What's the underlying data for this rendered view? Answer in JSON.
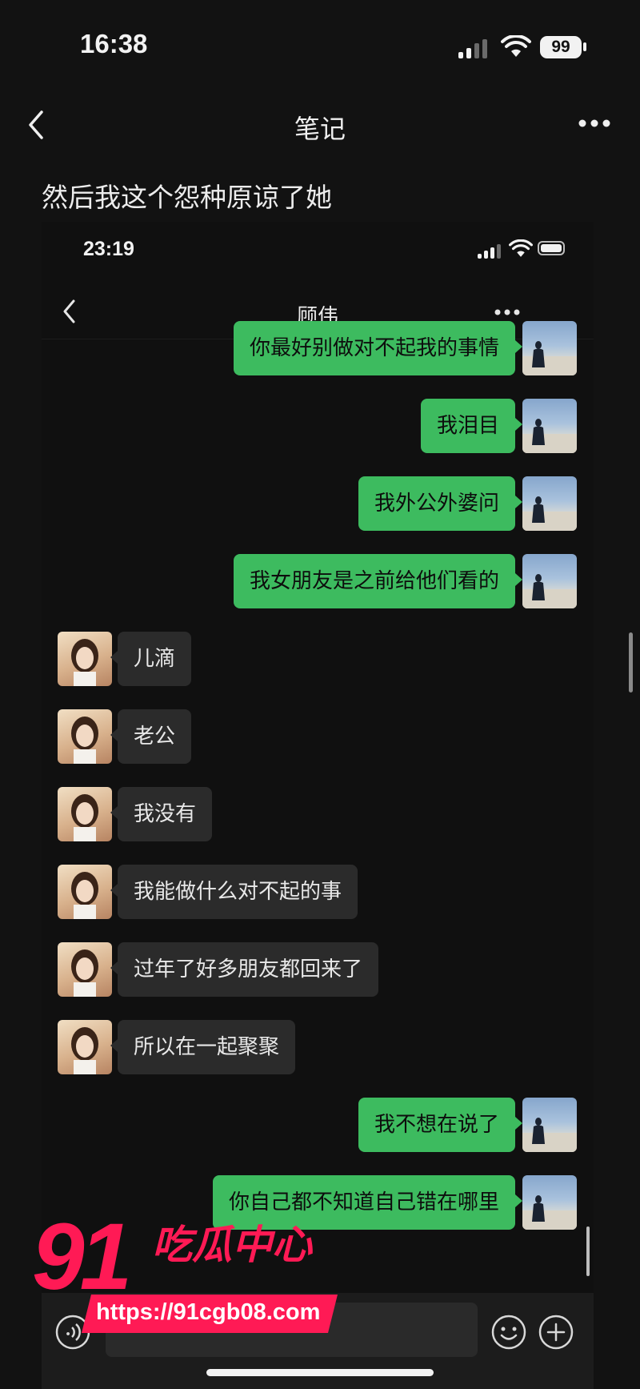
{
  "status_bar": {
    "time": "16:38",
    "battery": "99",
    "signal_icon": "signal-icon",
    "wifi_icon": "wifi-icon"
  },
  "nav": {
    "title": "笔记",
    "back_icon": "back-icon",
    "more_icon": "more-icon"
  },
  "caption": "然后我这个怨种原谅了她",
  "embedded": {
    "status_bar": {
      "time": "23:19"
    },
    "chat": {
      "title": "顾伟"
    },
    "messages": [
      {
        "side": "sent",
        "text": "你最好别做对不起我的事情"
      },
      {
        "side": "sent",
        "text": "我泪目"
      },
      {
        "side": "sent",
        "text": "我外公外婆问"
      },
      {
        "side": "sent",
        "text": "我女朋友是之前给他们看的"
      },
      {
        "side": "received",
        "text": "儿滴"
      },
      {
        "side": "received",
        "text": "老公"
      },
      {
        "side": "received",
        "text": "我没有"
      },
      {
        "side": "received",
        "text": "我能做什么对不起的事"
      },
      {
        "side": "received",
        "text": "过年了好多朋友都回来了"
      },
      {
        "side": "received",
        "text": "所以在一起聚聚"
      },
      {
        "side": "sent",
        "text": "我不想在说了"
      },
      {
        "side": "sent",
        "text": "你自己都不知道自己错在哪里"
      }
    ],
    "input_bar": {
      "voice_icon": "voice-icon",
      "emoji_icon": "emoji-icon",
      "add_icon": "add-icon"
    }
  },
  "watermark": {
    "number": "91",
    "text": "吃瓜中心",
    "url": "https://91cgb08.com"
  }
}
